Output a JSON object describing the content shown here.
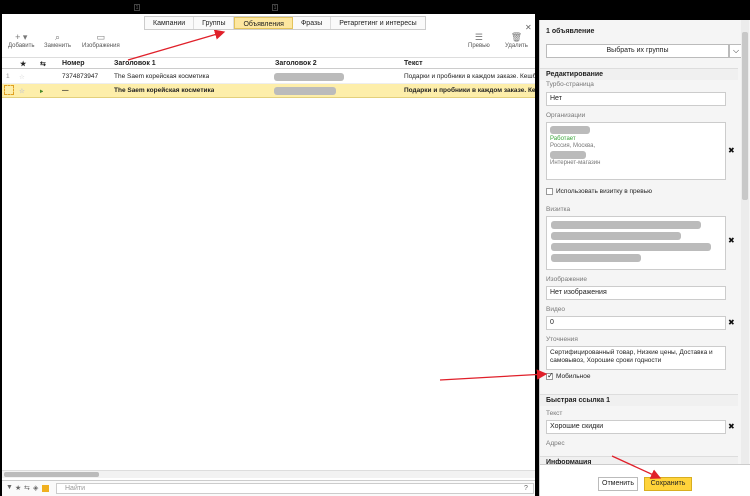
{
  "tabs": [
    "Кампании",
    "Группы",
    "Объявления",
    "Фразы",
    "Ретаргетинг и интересы"
  ],
  "active_tab": "Объявления",
  "toolbar": {
    "add": "Добавить",
    "replace": "Заменить",
    "images": "Изображения",
    "preview": "Превью",
    "delete": "Удалить"
  },
  "table": {
    "headers": [
      "Номер",
      "Заголовок 1",
      "Заголовок 2",
      "Текст"
    ],
    "rows": [
      {
        "num": "7374873947",
        "title1": "The Saem корейская косметика",
        "text": "Подарки и пробники в каждом заказе. Кешб"
      },
      {
        "num": "—",
        "title1": "The Saem корейская косметика",
        "text": "Подарки и пробники в каждом заказе. Ке"
      }
    ]
  },
  "find_placeholder": "Найти",
  "panel": {
    "title": "1 объявление",
    "pick_button": "Выбрать их группы",
    "section_edit": "Редактирование",
    "turbo_label": "Турбо-страница",
    "turbo_value": "Нет",
    "org_label": "Организации",
    "org_status": "Работает",
    "org_address": "Россия, Москва,",
    "org_type": "Интернет-магазин",
    "use_card": "Использовать визитку в превью",
    "card_label": "Визитка",
    "image_label": "Изображение",
    "image_value": "Нет изображения",
    "video_label": "Видео",
    "video_value": "0",
    "clarifications_label": "Уточнения",
    "clarifications_value": "Сертифицированный товар, Низкие цены, Доставка и самовывоз, Хорошие сроки годности",
    "mobile_label": "Мобильное",
    "quicklink_section": "Быстрая ссылка 1",
    "quicklink_text_label": "Текст",
    "quicklink_text_value": "Хорошие скидки",
    "quicklink_addr_label": "Адрес",
    "info_section": "Информация",
    "cancel": "Отменить",
    "save": "Сохранить"
  },
  "colors": {
    "accent": "#ffd33a",
    "selected_row": "#fdeeaa",
    "arrow": "#e0202a",
    "status_green": "#3aa53a"
  }
}
